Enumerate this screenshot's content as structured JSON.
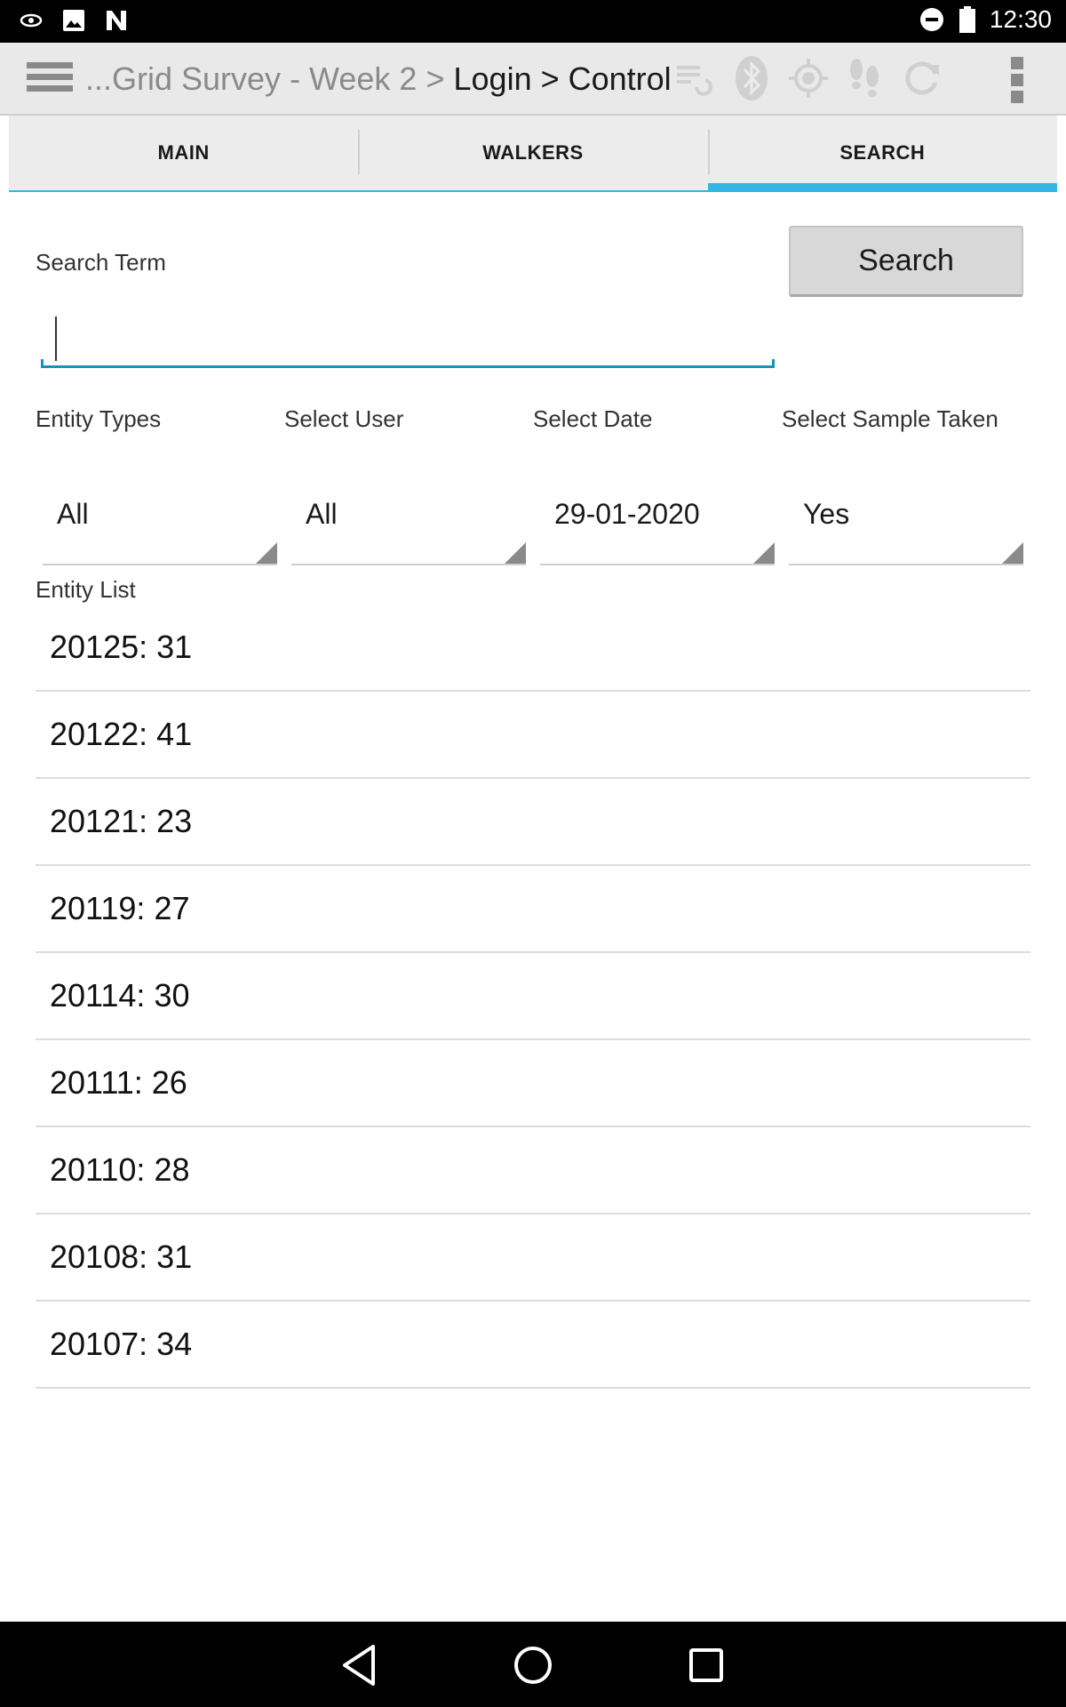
{
  "status_bar": {
    "time": "12:30",
    "icons": [
      "vpn-eye-icon",
      "image-icon",
      "n-logo-icon",
      "do-not-disturb-icon",
      "battery-icon"
    ]
  },
  "action_bar": {
    "breadcrumb_muted": "...Grid Survey - Week 2 >",
    "breadcrumb_strong": "Login > Control",
    "icons": [
      "sync-list-icon",
      "bluetooth-icon",
      "gps-icon",
      "footsteps-icon",
      "refresh-icon",
      "overflow-menu-icon"
    ]
  },
  "tabs": [
    {
      "label": "MAIN",
      "active": false
    },
    {
      "label": "WALKERS",
      "active": false
    },
    {
      "label": "SEARCH",
      "active": true
    }
  ],
  "search": {
    "term_label": "Search Term",
    "button_label": "Search",
    "input_value": "",
    "accent_color": "#33b5e5"
  },
  "filters": {
    "entity_types": {
      "label": "Entity Types",
      "value": "All"
    },
    "user": {
      "label": "Select User",
      "value": "All"
    },
    "date": {
      "label": "Select Date",
      "value": "29-01-2020"
    },
    "sample_taken": {
      "label": "Select Sample Taken",
      "value": "Yes"
    }
  },
  "entity_list": {
    "label": "Entity List",
    "items": [
      "20125: 31",
      "20122: 41",
      "20121: 23",
      "20119: 27",
      "20114: 30",
      "20111: 26",
      "20110: 28",
      "20108: 31",
      "20107: 34"
    ]
  },
  "nav_bar": {
    "icons": [
      "back-icon",
      "home-icon",
      "recents-icon"
    ]
  }
}
